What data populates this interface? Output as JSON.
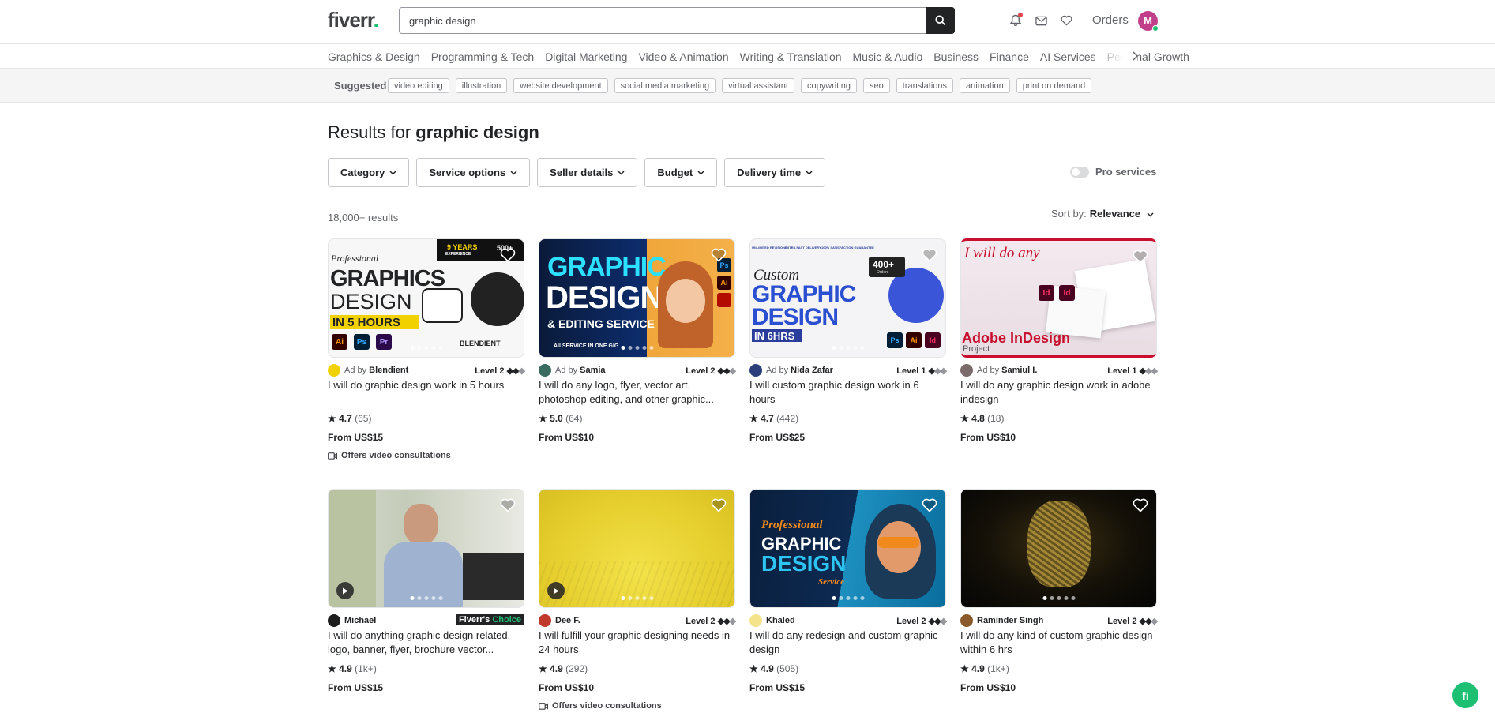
{
  "header": {
    "logo": "fiverr",
    "logo_dot": ".",
    "search_value": "graphic design",
    "orders_label": "Orders",
    "avatar_initial": "M"
  },
  "categories": [
    "Graphics & Design",
    "Programming & Tech",
    "Digital Marketing",
    "Video & Animation",
    "Writing & Translation",
    "Music & Audio",
    "Business",
    "Finance",
    "AI Services",
    "Personal Growth"
  ],
  "suggested": {
    "label": "Suggested",
    "chips": [
      "video editing",
      "illustration",
      "website development",
      "social media marketing",
      "virtual assistant",
      "copywriting",
      "seo",
      "translations",
      "animation",
      "print on demand"
    ]
  },
  "results": {
    "title_prefix": "Results for",
    "query": "graphic design",
    "count": "18,000+ results",
    "sort_label": "Sort by:",
    "sort_value": "Relevance",
    "pro_label": "Pro services",
    "filters": [
      "Category",
      "Service options",
      "Seller details",
      "Budget",
      "Delivery time"
    ]
  },
  "gigs": [
    {
      "ad": "Ad by",
      "seller": "Blendient",
      "level": "Level 2",
      "title": "I will do graphic design work in 5 hours",
      "rating": "4.7",
      "reviews": "(65)",
      "price": "From US$15",
      "video": "Offers video consultations",
      "avatar_color": "#f2d100"
    },
    {
      "ad": "Ad by",
      "seller": "Samia",
      "level": "Level 2",
      "title": "I will do any logo, flyer, vector art, photoshop editing, and other graphic...",
      "rating": "5.0",
      "reviews": "(64)",
      "price": "From US$10",
      "video": "",
      "avatar_color": "#3a6b5f"
    },
    {
      "ad": "Ad by",
      "seller": "Nida Zafar",
      "level": "Level 1",
      "title": "I will custom graphic design work in 6 hours",
      "rating": "4.7",
      "reviews": "(442)",
      "price": "From US$25",
      "video": "",
      "avatar_color": "#2c3e7a"
    },
    {
      "ad": "Ad by",
      "seller": "Samiul I.",
      "level": "Level 1",
      "title": "I will do any graphic design work in adobe indesign",
      "rating": "4.8",
      "reviews": "(18)",
      "price": "From US$10",
      "video": "",
      "avatar_color": "#7b6a6a"
    },
    {
      "ad": "",
      "seller": "Michael",
      "level": "",
      "choice": "Fiverr's Choice",
      "choice_parts": [
        "Fiverr's",
        "Choice"
      ],
      "title": "I will do anything graphic design related, logo, banner, flyer, brochure vector...",
      "rating": "4.9",
      "reviews": "(1k+)",
      "price": "From US$15",
      "video": "",
      "avatar_color": "#1e1e1e"
    },
    {
      "ad": "",
      "seller": "Dee F.",
      "level": "Level 2",
      "title": "I will fulfill your graphic designing needs in 24 hours",
      "rating": "4.9",
      "reviews": "(292)",
      "price": "From US$10",
      "video": "Offers video consultations",
      "avatar_color": "#c0392b"
    },
    {
      "ad": "",
      "seller": "Khaled",
      "level": "Level 2",
      "title": "I will do any redesign and custom graphic design",
      "rating": "4.9",
      "reviews": "(505)",
      "price": "From US$15",
      "video": "",
      "avatar_color": "#f4e38a"
    },
    {
      "ad": "",
      "seller": "Raminder Singh",
      "level": "Level 2",
      "title": "I will do any kind of custom graphic design within 6 hrs",
      "rating": "4.9",
      "reviews": "(1k+)",
      "price": "From US$10",
      "video": "",
      "avatar_color": "#8b5a2b"
    }
  ],
  "thumbs": {
    "t1": {
      "years": "9 YEARS",
      "experience": "EXPERIENCE",
      "count": "500+",
      "pro": "Professional",
      "big1": "GRAPHICS",
      "big2": "DESIGN",
      "hours": "IN 5 HOURS",
      "brand": "BLENDIENT"
    },
    "t2": {
      "l1": "GRAPHIC",
      "l2": "DESIGN",
      "l3": "& EDITING SERVICE",
      "l4": "All SERVICE IN ONE GIG"
    },
    "t3": {
      "custom": "Custom",
      "l1": "GRAPHIC",
      "l2": "DESIGN",
      "l3": "IN 6HRS",
      "badge": "400+",
      "badge_sub": "Orders",
      "top1": "UNLIMITED REVISIONS",
      "top2": "EXTRA FAST DELIVERY",
      "top3": "100% SATISFACTION GUARANTEE"
    },
    "t4": {
      "head": "I will do any",
      "foot": "Adobe InDesign",
      "sub": "Project"
    },
    "t7": {
      "pro": "Professional",
      "l1": "GRAPHIC",
      "l2": "DESIGN",
      "svc": "Service"
    }
  },
  "chat_label": "fi",
  "colors": {
    "accent": "#1dbf73",
    "dark": "#222325",
    "muted": "#62646a",
    "border": "#e4e5e7",
    "notif": "#e2444a",
    "avatar": "#c13f8a"
  }
}
